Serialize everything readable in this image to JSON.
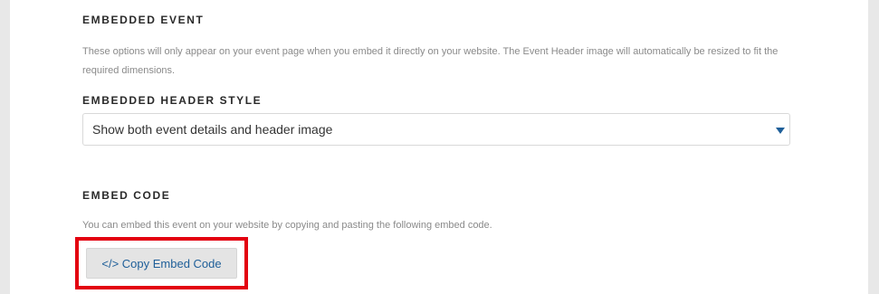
{
  "embedded_event": {
    "heading": "EMBEDDED EVENT",
    "description": "These options will only appear on your event page when you embed it directly on your website. The Event Header image will automatically be resized to fit the required dimensions."
  },
  "embedded_header_style": {
    "heading": "EMBEDDED HEADER STYLE",
    "selected_value": "Show both event details and header image"
  },
  "embed_code": {
    "heading": "EMBED CODE",
    "description": "You can embed this event on your website by copying and pasting the following embed code.",
    "copy_button_label": "</> Copy Embed Code"
  },
  "colors": {
    "accent": "#1f5f99",
    "highlight_border": "#e3000f",
    "page_background": "#e8e8e8"
  }
}
